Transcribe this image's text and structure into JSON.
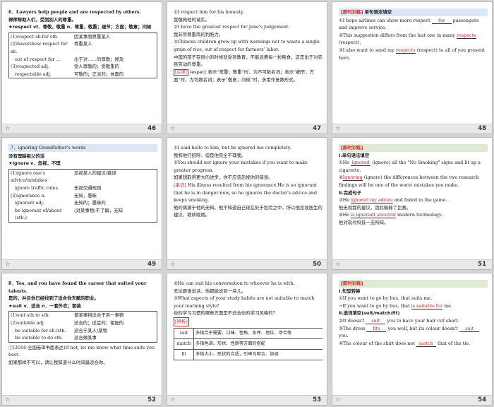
{
  "slides": [
    {
      "num": "46",
      "lines": [
        "6．Lawyers help people and are respected by others.",
        "律师帮助人们，受到别人的尊重。",
        "★respect vt．尊敬，敬重 n．尊重，敬重；细节；方面；敬意；问候",
        "(1)respect sb.for sth.",
        "因某事而尊重某人",
        "(2)have/show respect for sb.",
        "尊重某人",
        "out of respect for ...",
        "出于对……的尊敬；顾及",
        "(3)respected adj.",
        "受人尊敬的；受敬重的",
        "respectable adj.",
        "可敬的；正派的；体面的"
      ]
    },
    {
      "num": "47",
      "lines": [
        "①I respect him for his honesty.",
        "我敬佩他的诚实。",
        "②I have the greatest respect for Jane's judgement.",
        "我非常尊重简的判断力。",
        "③Chinese children grow up with warnings not to waste a single grain of rice, out of respect for farmers' labor.",
        "中国的孩子在很小的时候就受到教育，不能浪费每一粒粮食，这是出于对农民劳动的尊重。",
        "[点津]",
        "respect 表示“尊重；敬重”时，为不可数名词；表示“细节；方面”时，为可数名词；表示“敬意；问候”时，多用作复数形式。"
      ]
    },
    {
      "num": "48",
      "lines": [
        "[即时训练]",
        "单句语法填空",
        "①I hope airlines can show more respect",
        "for",
        "passengers and improve service.",
        "②This suggestion differs from the last one in many",
        "respects",
        "(respect)．",
        "③I also want to send my",
        "respects",
        "(respect) to all of you present here."
      ]
    },
    {
      "num": "49",
      "lines": [
        "7．ignoring Grandfather's words",
        "没有理睬祖父的话",
        "★ignore v．忽视，不理",
        "(1)ignore one's advice/mistakes",
        "忽视某人的建议/错误",
        "ignore traffic rules",
        "无视交通规则",
        "(2)ignorance n.",
        "无知，愚昧",
        "ignorant adj.",
        "无知的；愚昧的",
        "be ignorant of/about (sth.)",
        "(对某事物)不了解，无知"
      ]
    },
    {
      "num": "50",
      "lines": [
        "①I said hello to him, but he ignored me completely.",
        "我和他打招呼，但是他完全不理我。",
        "②You should not ignore your mistakes if you want to make greater progress.",
        "如果想取得更大的进步，你不应该忽视你的错误。",
        "[串记]",
        "His illness resulted from his ignorance.He is so ignorant that he is in danger now, so he ignores the doctor's advice and keeps smoking.",
        "他的病源于他的无知。他不知道自己现在处于危险之中，所以他忽视医生的建议，继续吸烟。"
      ]
    },
    {
      "num": "51",
      "lines": [
        "[即时训练]",
        "Ⅰ.单句语法填空",
        "①He",
        "ignored",
        "(ignore) all the \"No Smoking\" signs and lit up a cigarette.",
        "②",
        "Ignoring",
        "(ignore) the differences between the two research findings will be one of the worst mistakes you make.",
        "Ⅱ.完成句子",
        "③He",
        "ignored my advice",
        "and failed in the game.",
        "他无视我的建议，因此输掉了比赛。",
        "④He",
        "is ignorant about/of",
        "modern technology.",
        "他对现代科技一无所知。"
      ]
    },
    {
      "num": "52",
      "lines": [
        "8．Yes, and you have found the career that suited your talents.",
        "是的，并且你已经找到了适合你天赋的职业。",
        "★suit v．适合 n．一套外衣；套装",
        "(1)suit sth.to sth.",
        "使某事物适合于另一事物",
        "(2)suitable adj.",
        "适合的；适宜的；相配的",
        "be suitable for sb./sth.",
        "适合于某人/某物",
        "be suitable to do sth.",
        "适合做某事",
        "①(2016·全国卷Ⅲ书面表达)If not, let me know what time suits you best.",
        "如果那样不可以，请让我知道什么时间最适合你。"
      ]
    },
    {
      "num": "53",
      "lines": [
        "②He can suit his conversation to whoever he is with.",
        "无论跟谁说话，他都能说到一块儿。",
        "③What aspects of your study habits are not suitable to match your learning style?",
        "你的学习习惯的哪些方面是不适合你的学习风格的？",
        "[辨析]",
        "suit",
        "多指合乎需要、口味、性格、条件、地位、场合等",
        "match",
        "多指色调、形状、性质等方面的搭配",
        "fit",
        "多指大小、形状的合适，引申为吻合、协调"
      ]
    },
    {
      "num": "54",
      "lines": [
        "[即时训练]",
        "Ⅰ.句型转换",
        "①If you want to go by bus, that suits me.",
        "→If you want to go by bus, that",
        "is suitable for",
        "me.",
        "Ⅱ.选词填空(suit/match/fit)",
        "②It doesn't",
        "suit",
        "you to have your hair cut short.",
        "③The dress",
        "fits",
        "you well, but its colour doesn't",
        "suit",
        "you.",
        "④The colour of the shirt does not",
        "match",
        "that of the tie."
      ]
    }
  ]
}
